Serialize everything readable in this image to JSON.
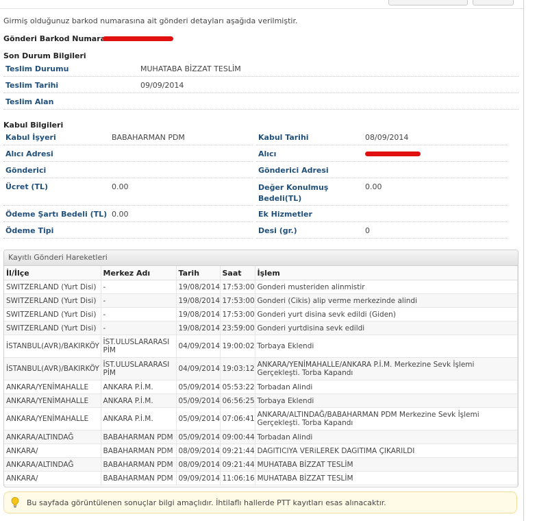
{
  "intro": "Girmiş olduğunuz barkod numarasına ait gönderi detayları aşağıda verilmiştir.",
  "barcode_label": "Gönderi Barkod Numarası:",
  "son_durum": {
    "title": "Son Durum Bilgileri",
    "rows": [
      {
        "label": "Teslim Durumu",
        "value": "MUHATABA BİZZAT TESLİM"
      },
      {
        "label": "Teslim Tarihi",
        "value": "09/09/2014"
      },
      {
        "label": "Teslim Alan",
        "value": ""
      }
    ]
  },
  "kabul": {
    "title": "Kabul Bilgileri",
    "left": [
      {
        "label": "Kabul İşyeri",
        "value": "BABAHARMAN PDM"
      },
      {
        "label": "Alıcı Adresi",
        "value": ""
      },
      {
        "label": "Gönderici",
        "value": ""
      },
      {
        "label": "Ücret (TL)",
        "value": "0.00"
      },
      {
        "label": "Ödeme Şartı Bedeli (TL)",
        "value": "0.00"
      },
      {
        "label": "Ödeme Tipi",
        "value": ""
      }
    ],
    "right": [
      {
        "label": "Kabul Tarihi",
        "value": "08/09/2014"
      },
      {
        "label": "Alıcı",
        "value": ""
      },
      {
        "label": "Gönderici Adresi",
        "value": ""
      },
      {
        "label": "Değer Konulmuş Bedeli(TL)",
        "value": "0.00"
      },
      {
        "label": "Ek Hizmetler",
        "value": ""
      },
      {
        "label": "Desi (gr.)",
        "value": "0"
      }
    ]
  },
  "movements": {
    "title": "Kayıtlı Gönderi Hareketleri",
    "headers": [
      "İl/İlçe",
      "Merkez Adı",
      "Tarih",
      "Saat",
      "İşlem"
    ],
    "rows": [
      [
        "SWITZERLAND (Yurt Disi)",
        "-",
        "19/08/2014",
        "17:53:00",
        "Gonderi musteriden alinmistir"
      ],
      [
        "SWITZERLAND (Yurt Disi)",
        "-",
        "19/08/2014",
        "17:53:00",
        "Gonderi (Cikis) alip verme merkezinde alindi"
      ],
      [
        "SWITZERLAND (Yurt Disi)",
        "-",
        "19/08/2014",
        "17:53:00",
        "Gonderi yurt disina sevk edildi (Giden)"
      ],
      [
        "SWITZERLAND (Yurt Disi)",
        "-",
        "19/08/2014",
        "23:59:00",
        "Gonderi yurtdisina sevk edildi"
      ],
      [
        "İSTANBUL(AVR)/BAKIRKÖY",
        "İST.ULUSLARARASI PİM",
        "04/09/2014",
        "19:00:02",
        "Torbaya Eklendi"
      ],
      [
        "İSTANBUL(AVR)/BAKIRKÖY",
        "İST.ULUSLARARASI PİM",
        "04/09/2014",
        "19:03:12",
        "ANKARA/YENİMAHALLE/ANKARA P.İ.M. Merkezine Sevk İşlemi Gerçekleşti. Torba Kapandı"
      ],
      [
        "ANKARA/YENİMAHALLE",
        "ANKARA P.İ.M.",
        "05/09/2014",
        "05:53:22",
        "Torbadan Alindi"
      ],
      [
        "ANKARA/YENİMAHALLE",
        "ANKARA P.İ.M.",
        "05/09/2014",
        "06:56:25",
        "Torbaya Eklendi"
      ],
      [
        "ANKARA/YENİMAHALLE",
        "ANKARA P.İ.M.",
        "05/09/2014",
        "07:06:41",
        "ANKARA/ALTINDAĞ/BABAHARMAN PDM Merkezine Sevk İşlemi Gerçekleşti. Torba Kapandı"
      ],
      [
        "ANKARA/ALTINDAĞ",
        "BABAHARMAN PDM",
        "05/09/2014",
        "09:00:44",
        "Torbadan Alindi"
      ],
      [
        "ANKARA/",
        "BABAHARMAN PDM",
        "08/09/2014",
        "09:21:44",
        "DAGITICIYA VERiLEREK DAGITIMA ÇIKARILDI"
      ],
      [
        "ANKARA/ALTINDAĞ",
        "BABAHARMAN PDM",
        "08/09/2014",
        "09:21:44",
        "MUHATABA BİZZAT TESLİM"
      ],
      [
        "ANKARA/",
        "BABAHARMAN PDM",
        "09/09/2014",
        "11:06:16",
        "MUHATABA BİZZAT TESLİM"
      ]
    ]
  },
  "notice": {
    "icon": "lightbulb-icon",
    "text": "Bu sayfada görüntülenen sonuçlar bilgi amaçlıdır. İhtilaflı hallerde PTT kayıtları esas alınacaktır."
  },
  "colors": {
    "label": "#1f4f7a",
    "redaction": "#e01010"
  }
}
